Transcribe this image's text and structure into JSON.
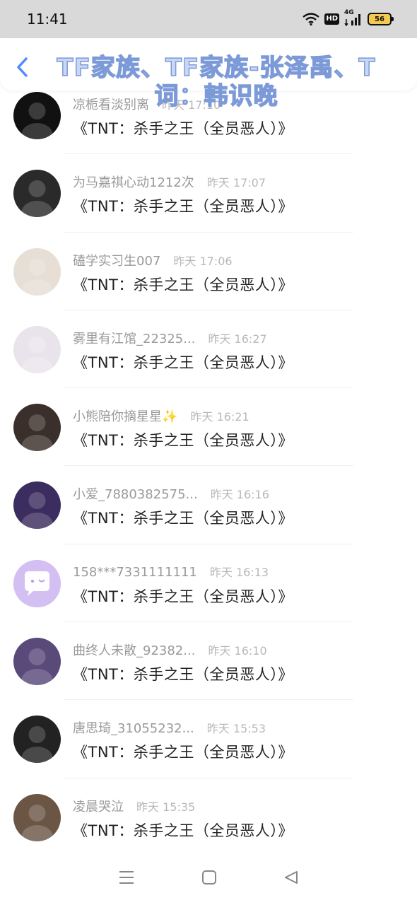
{
  "status_bar": {
    "time": "11:41",
    "network": "4G",
    "hd": "HD",
    "battery": "56"
  },
  "header": {
    "title": "TF家族、TF家族-张泽禹、T 词：韩识晚",
    "title_color": "#7d9ad8"
  },
  "messages": [
    {
      "name": "凉栀看淡别离",
      "time": "昨天 17:10",
      "text": "《TNT：杀手之王（全员恶人）》",
      "avatar_color": "#111111"
    },
    {
      "name": "为马嘉祺心动1212次",
      "time": "昨天 17:07",
      "text": "《TNT：杀手之王（全员恶人）》",
      "avatar_color": "#2a2a2a"
    },
    {
      "name": "磕学实习生007",
      "time": "昨天 17:06",
      "text": "《TNT：杀手之王（全员恶人）》",
      "avatar_color": "#e7ded6"
    },
    {
      "name": "雾里有江馆_22325...",
      "time": "昨天 16:27",
      "text": "《TNT：杀手之王（全员恶人）》",
      "avatar_color": "#e9e4ec"
    },
    {
      "name": "小熊陪你摘星星✨",
      "time": "昨天 16:21",
      "text": "《TNT：杀手之王（全员恶人）》",
      "avatar_color": "#3a2f2a"
    },
    {
      "name": "小爱_7880382575...",
      "time": "昨天 16:16",
      "text": "《TNT：杀手之王（全员恶人）》",
      "avatar_color": "#3b2d5f"
    },
    {
      "name": "158***7331111111",
      "time": "昨天 16:13",
      "text": "《TNT：杀手之王（全员恶人）》",
      "avatar_color": "#d4bff3"
    },
    {
      "name": "曲终人未散_92382...",
      "time": "昨天 16:10",
      "text": "《TNT：杀手之王（全员恶人）》",
      "avatar_color": "#5a4a7a"
    },
    {
      "name": "唐思琦_31055232...",
      "time": "昨天 15:53",
      "text": "《TNT：杀手之王（全员恶人）》",
      "avatar_color": "#222222"
    },
    {
      "name": "凌晨哭泣",
      "time": "昨天 15:35",
      "text": "《TNT：杀手之王（全员恶人）》",
      "avatar_color": "#6b5646"
    }
  ],
  "nav": {
    "menu_icon": "menu-icon",
    "home_icon": "home-icon",
    "back_icon": "back-triangle-icon"
  }
}
